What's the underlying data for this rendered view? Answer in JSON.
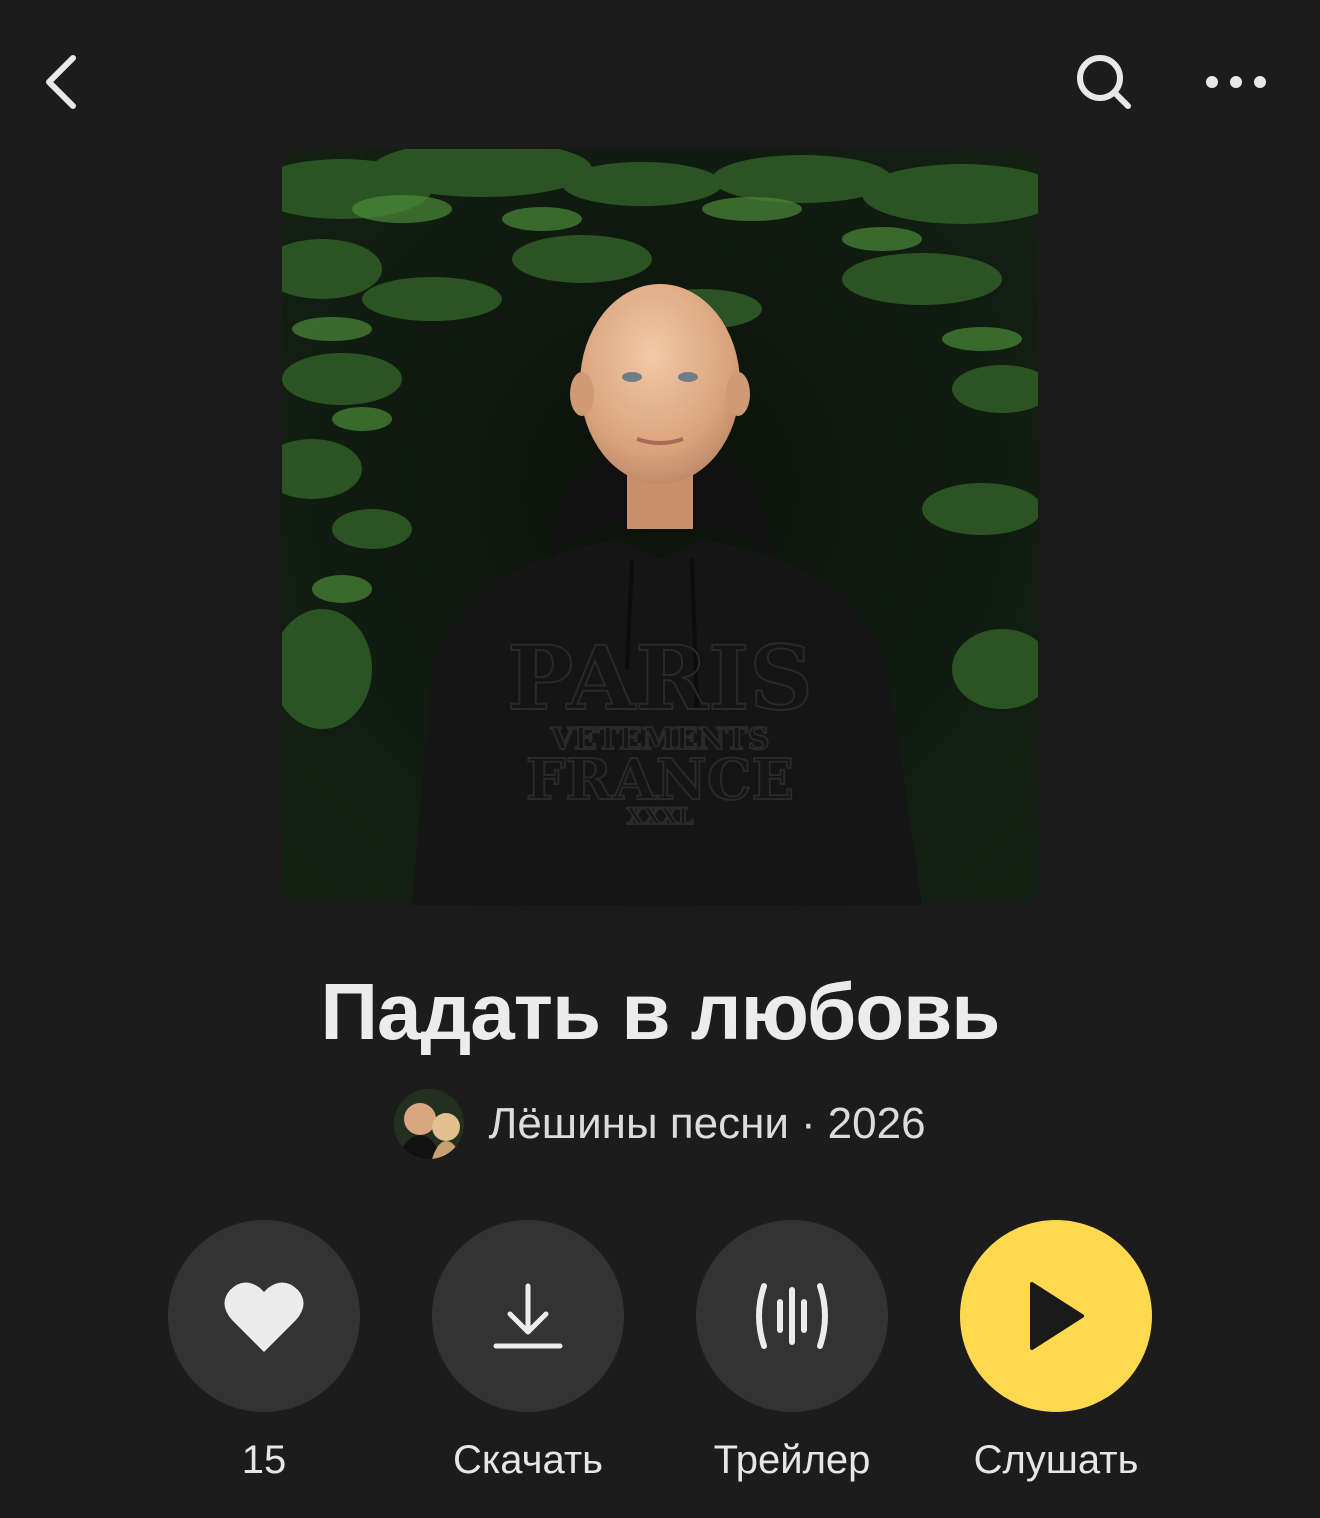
{
  "header": {
    "back_icon": "chevron-left-icon",
    "search_icon": "search-icon",
    "more_icon": "more-dots-icon"
  },
  "album": {
    "title": "Падать в любовь",
    "artist": "Лёшины песни",
    "separator": "·",
    "year": "2026",
    "cover_hoodie_text": [
      "PARIS",
      "VETEMENTS",
      "FRANCE",
      "XXXL"
    ]
  },
  "actions": [
    {
      "icon": "heart-icon",
      "label": "15"
    },
    {
      "icon": "download-icon",
      "label": "Скачать"
    },
    {
      "icon": "trailer-waveform-icon",
      "label": "Трейлер"
    },
    {
      "icon": "play-icon",
      "label": "Слушать"
    }
  ],
  "colors": {
    "background": "#1c1c1c",
    "button_bg": "#333333",
    "accent": "#fed94e",
    "text": "#ececec"
  }
}
